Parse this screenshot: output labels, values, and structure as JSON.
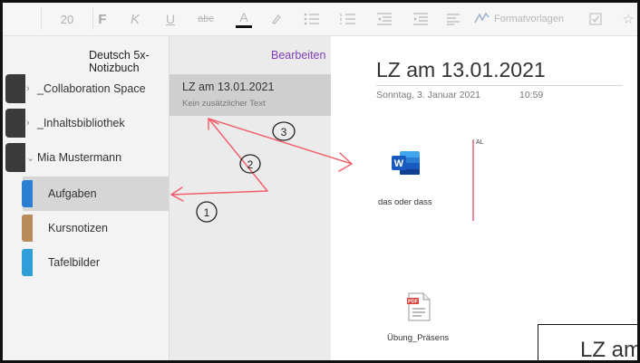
{
  "toolbar": {
    "font_size": "20",
    "bold": "F",
    "italic": "K",
    "underline": "U",
    "strike": "abc",
    "color": "A",
    "styles_label": "Formatvorlagen",
    "icons": [
      "highlighter-icon",
      "bullet-list-icon",
      "numbered-list-icon",
      "outdent-icon",
      "indent-icon",
      "align-icon",
      "pen-icon",
      "checkbox-icon",
      "star-icon"
    ]
  },
  "sections": {
    "notebook_title": "Deutsch 5x-Notizbuch",
    "groups": [
      {
        "label": "_Collaboration Space",
        "expanded": false
      },
      {
        "label": "_Inhaltsbibliothek",
        "expanded": false
      },
      {
        "label": "Mia Mustermann",
        "expanded": true
      }
    ],
    "children": [
      {
        "label": "Aufgaben",
        "color": "#2a7fd3",
        "selected": true
      },
      {
        "label": "Kursnotizen",
        "color": "#b78b5a",
        "selected": false
      },
      {
        "label": "Tafelbilder",
        "color": "#2f9ed8",
        "selected": false
      }
    ]
  },
  "pages": {
    "edit_label": "Bearbeiten",
    "items": [
      {
        "title": "LZ am 13.01.2021",
        "subtitle": "Kein zusätzlicher Text"
      }
    ]
  },
  "canvas": {
    "heading": "LZ am 13.01.2021",
    "date": "Sonntag, 3. Januar 2021",
    "time": "10:59",
    "word_file": "das oder dass",
    "pdf_file": "Übung_Präsens",
    "margin_mark": "AL",
    "preview_text": "LZ am"
  },
  "annotations": {
    "step_labels": [
      "1",
      "2",
      "3"
    ],
    "arrow_color": "#f25c6a"
  }
}
